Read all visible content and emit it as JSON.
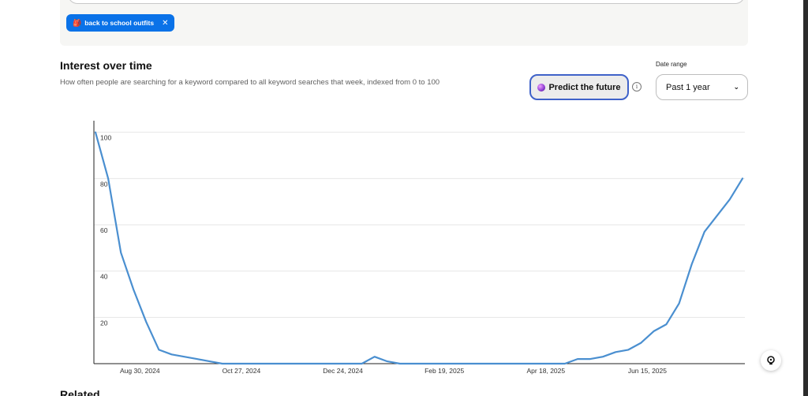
{
  "filter": {
    "chip_label": "back to school outfits",
    "chip_emoji": "🎒",
    "chip_close": "✕"
  },
  "section": {
    "title": "Interest over time",
    "subtitle": "How often people are searching for a keyword compared to all keyword searches that week, indexed from 0 to 100"
  },
  "predict": {
    "label": "Predict the future",
    "info": "i"
  },
  "date_range": {
    "label": "Date range",
    "value": "Past 1 year",
    "chevron": "⌄"
  },
  "colors": {
    "accent": "#0a72e8",
    "line": "#4a8fd0",
    "predict_border": "#3f62c9"
  },
  "chart_data": {
    "type": "line",
    "title": "",
    "xlabel": "",
    "ylabel": "",
    "ylim": [
      0,
      105
    ],
    "yticks": [
      20,
      40,
      60,
      80,
      100
    ],
    "grid": true,
    "x_tick_labels": [
      "Aug 30, 2024",
      "Oct 27, 2024",
      "Dec 24, 2024",
      "Feb 19, 2025",
      "Apr 18, 2025",
      "Jun 15, 2025"
    ],
    "x_tick_weeks": [
      3.5,
      11.5,
      19.5,
      27.5,
      35.5,
      43.5
    ],
    "series": [
      {
        "values": [
          100,
          80,
          48,
          32,
          18,
          6,
          4,
          3,
          2,
          1,
          0,
          0,
          0,
          0,
          0,
          0,
          0,
          0,
          0,
          0,
          0,
          0,
          3,
          1,
          0,
          0,
          0,
          0,
          0,
          0,
          0,
          0,
          0,
          0,
          0,
          0,
          0,
          0,
          2,
          2,
          3,
          5,
          6,
          9,
          14,
          17,
          26,
          43,
          57,
          64,
          71,
          80
        ]
      }
    ]
  },
  "related": {
    "title": "Related trends"
  }
}
